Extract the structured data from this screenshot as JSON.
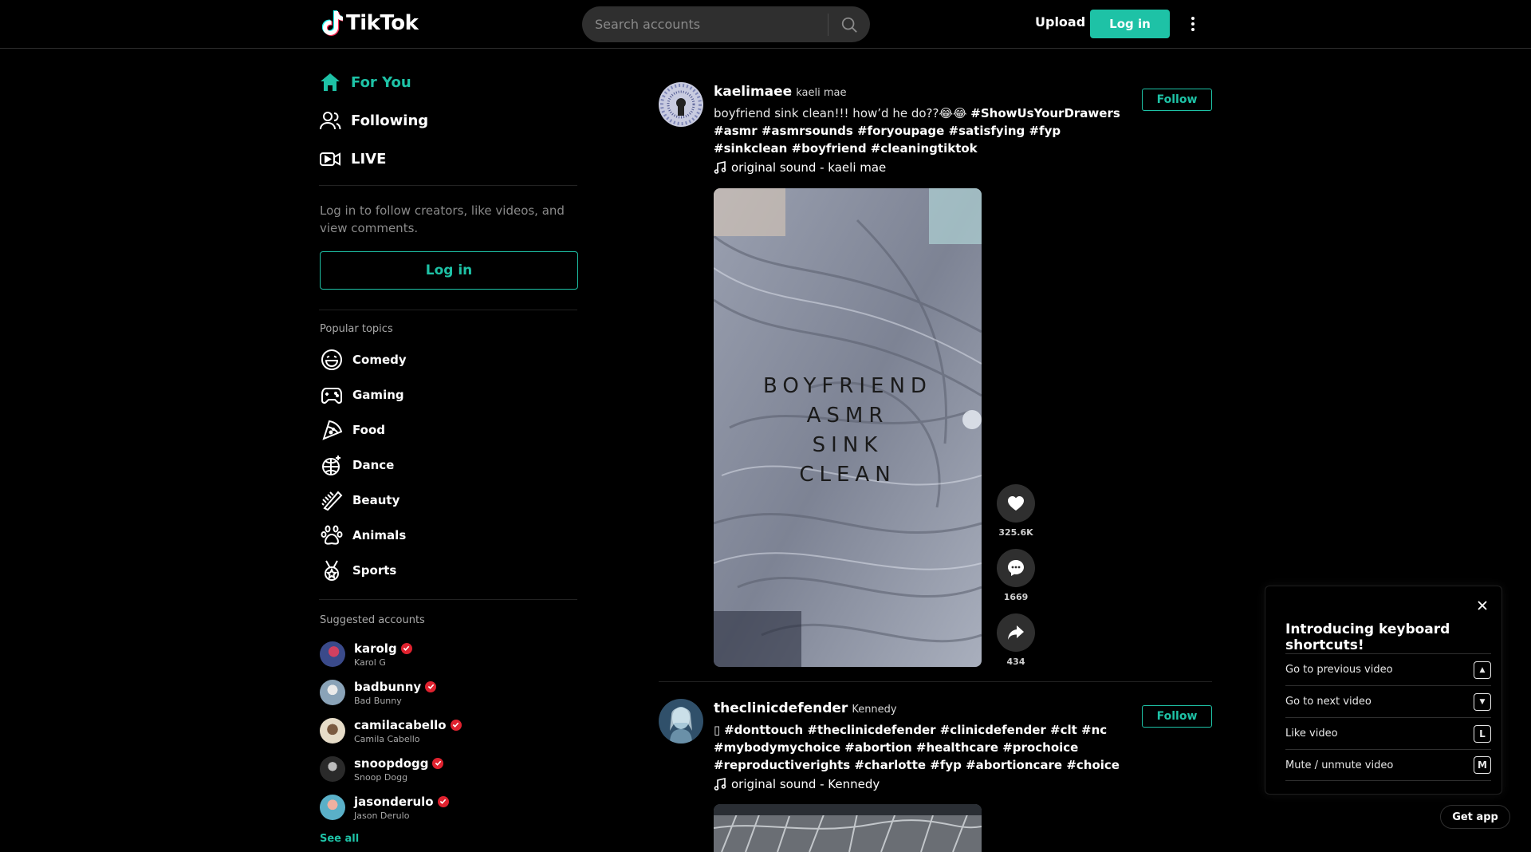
{
  "header": {
    "logo_text": "TikTok",
    "search_placeholder": "Search accounts",
    "upload_label": "Upload",
    "login_label": "Log in"
  },
  "sidebar": {
    "nav": [
      {
        "label": "For You",
        "icon": "home-icon",
        "active": true
      },
      {
        "label": "Following",
        "icon": "people-icon",
        "active": false
      },
      {
        "label": "LIVE",
        "icon": "live-icon",
        "active": false
      }
    ],
    "login_note": "Log in to follow creators, like videos, and view comments.",
    "login_label": "Log in",
    "popular_title": "Popular topics",
    "topics": [
      {
        "label": "Comedy",
        "icon": "laugh-icon"
      },
      {
        "label": "Gaming",
        "icon": "gamepad-icon"
      },
      {
        "label": "Food",
        "icon": "pizza-icon"
      },
      {
        "label": "Dance",
        "icon": "disco-ball-icon"
      },
      {
        "label": "Beauty",
        "icon": "comb-icon"
      },
      {
        "label": "Animals",
        "icon": "paw-icon"
      },
      {
        "label": "Sports",
        "icon": "medal-icon"
      }
    ],
    "suggested_title": "Suggested accounts",
    "accounts": [
      {
        "id": "karolg",
        "name": "Karol G",
        "color": "#3a4a8a"
      },
      {
        "id": "badbunny",
        "name": "Bad Bunny",
        "color": "#8aa3b8"
      },
      {
        "id": "camilacabello",
        "name": "Camila Cabello",
        "color": "#c9b79c"
      },
      {
        "id": "snoopdogg",
        "name": "Snoop Dogg",
        "color": "#4a4a4a"
      },
      {
        "id": "jasonderulo",
        "name": "Jason Derulo",
        "color": "#5ab0c8"
      }
    ],
    "see_all": "See all"
  },
  "posts": [
    {
      "author_id": "kaelimaee",
      "author_name": "kaeli mae",
      "caption_text": "boyfriend sink clean!!! how’d he do??😂😂 ",
      "tags": "#ShowUsYourDrawers #asmr #asmrsounds #foryoupage #satisfying #fyp #sinkclean #boyfriend #cleaningtiktok",
      "sound": "original sound - kaeli mae",
      "follow_label": "Follow",
      "video_overlay": [
        "BOYFRIEND",
        "ASMR",
        "SINK",
        "CLEAN"
      ],
      "likes": "325.6K",
      "comments": "1669",
      "shares": "434"
    },
    {
      "author_id": "theclinicdefender",
      "author_name": "Kennedy",
      "caption_text": "▯ ",
      "tags": "#donttouch #theclinicdefender #clinicdefender #clt #nc #mybodymychoice #abortion #healthcare #prochoice #reproductiverights #charlotte #fyp #abortioncare #choice",
      "sound": "original sound - Kennedy",
      "follow_label": "Follow"
    }
  ],
  "shortcuts": {
    "title": "Introducing keyboard shortcuts!",
    "items": [
      {
        "label": "Go to previous video",
        "key": "▲"
      },
      {
        "label": "Go to next video",
        "key": "▼"
      },
      {
        "label": "Like video",
        "key": "L"
      },
      {
        "label": "Mute / unmute video",
        "key": "M"
      }
    ]
  },
  "get_app_label": "Get app",
  "colors": {
    "accent": "#1ec2a6",
    "verified": "#e0222f",
    "background": "#000000"
  }
}
